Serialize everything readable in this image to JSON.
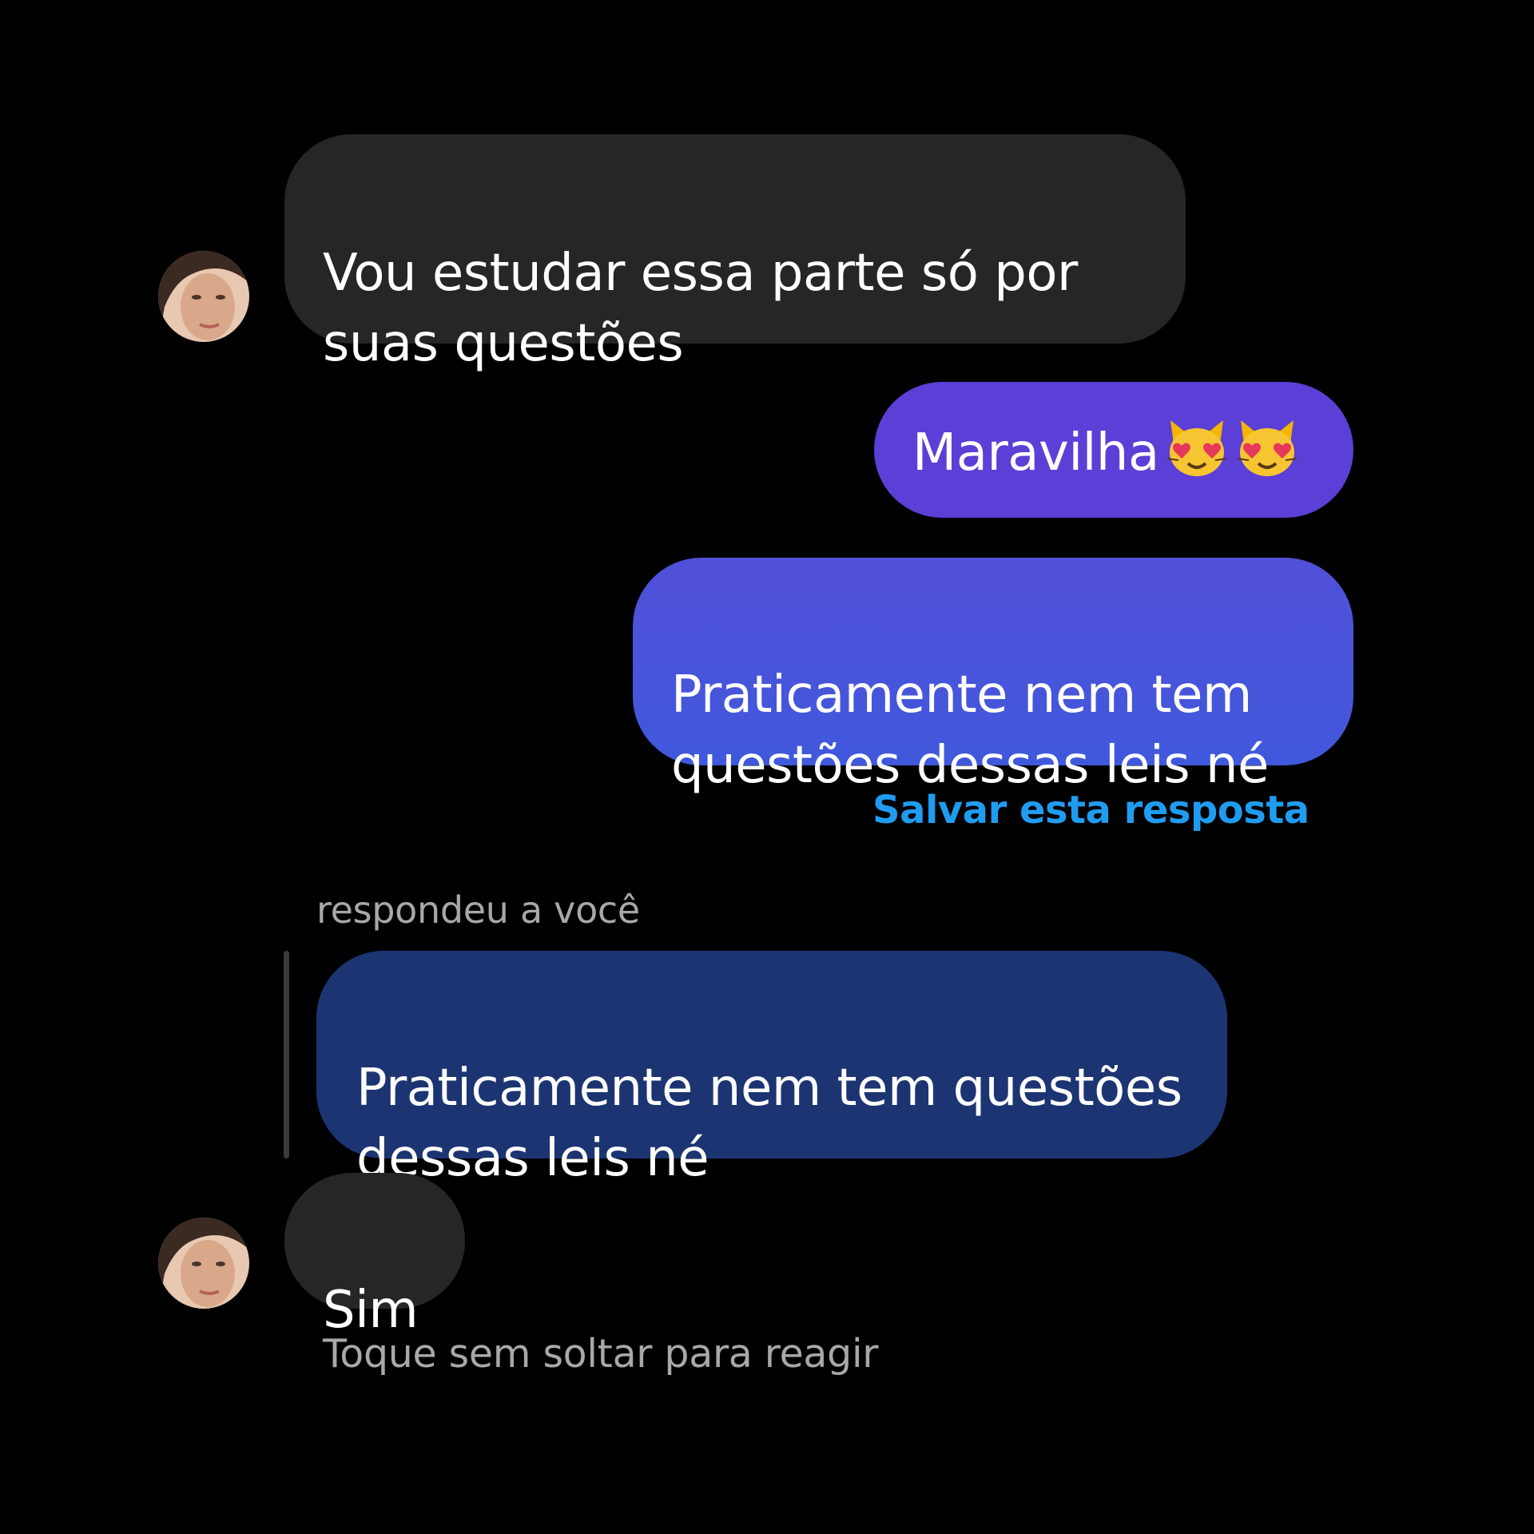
{
  "messages": {
    "m1": {
      "text": "Vou estudar essa parte só por\nsuas questões"
    },
    "m2": {
      "text": "Maravilha",
      "emoji": [
        "smiling-cat-heart-eyes",
        "smiling-cat-heart-eyes"
      ]
    },
    "m3": {
      "text": "Praticamente nem tem\nquestões dessas leis né"
    },
    "save_reply": "Salvar esta resposta",
    "reply": {
      "label": "respondeu a você",
      "quoted_text": "Praticamente nem tem questões\ndessas leis né"
    },
    "m4": {
      "text": "Sim"
    },
    "hint": "Toque sem soltar para reagir"
  },
  "colors": {
    "background": "#000000",
    "incoming_bubble": "#262626",
    "outgoing_gradient_top": "#5b3fd6",
    "outgoing_gradient_bottom": "#4056db",
    "quoted_bubble": "#1c3472",
    "link": "#1f9cf0",
    "muted_text": "#a8a8a8"
  }
}
